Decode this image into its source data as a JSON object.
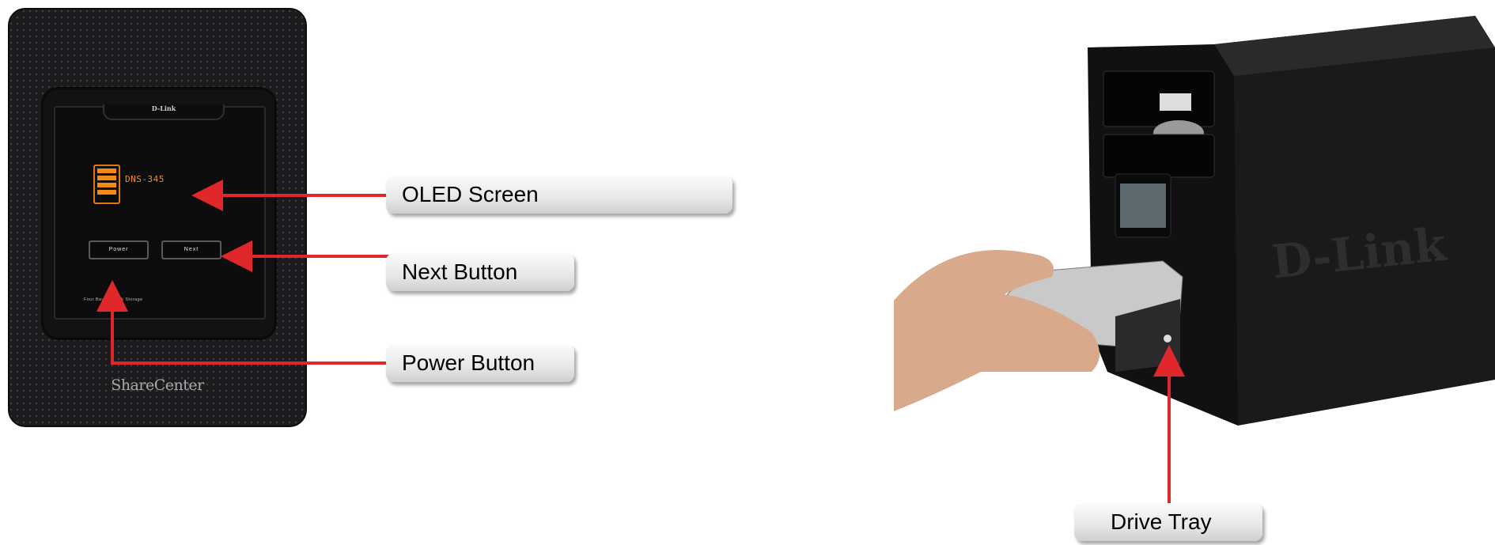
{
  "device_front": {
    "brand_badge": "D-Link",
    "oled_text": "DNS-345",
    "power_label": "Power",
    "next_label": "Next",
    "panel_caption": "Four Bay Network Storage",
    "product_name": "ShareCenter"
  },
  "device_side": {
    "brand_text": "D-Link"
  },
  "callouts": {
    "oled": "OLED Screen",
    "next": "Next Button",
    "power": "Power Button",
    "tray": "Drive Tray"
  },
  "colors": {
    "arrow": "#e0282b",
    "oled": "#f0921a",
    "device_body": "#1b1b1d"
  }
}
